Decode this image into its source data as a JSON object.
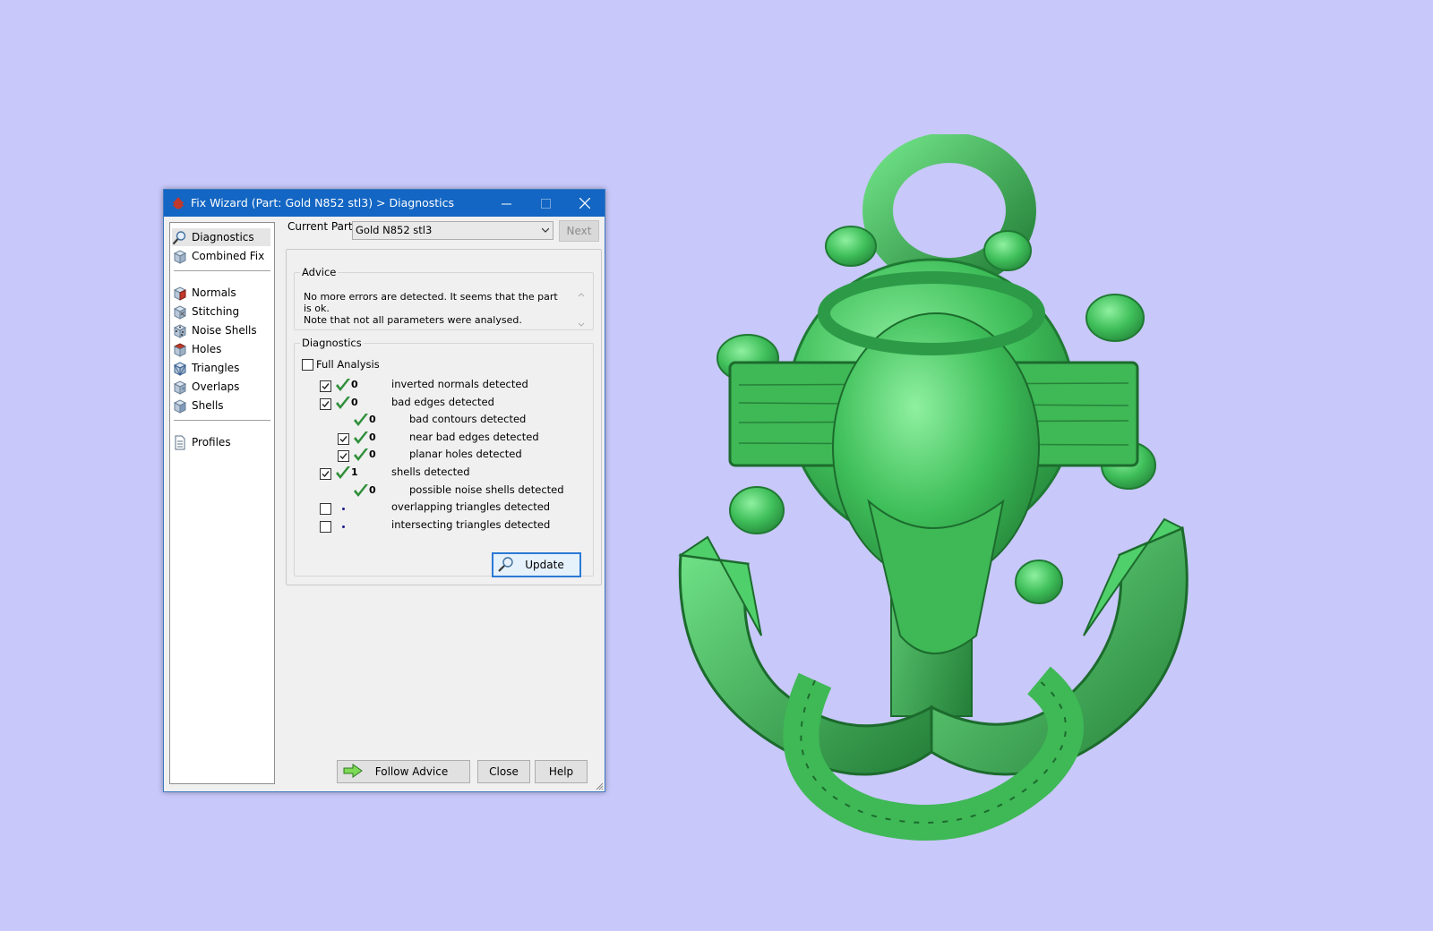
{
  "window": {
    "title": "Fix Wizard (Part: Gold N852 stl3) > Diagnostics"
  },
  "nav": {
    "items_top": [
      {
        "label": "Diagnostics",
        "icon": "magnifier-icon"
      },
      {
        "label": "Combined Fix",
        "icon": "cube-icon"
      }
    ],
    "items_mid": [
      {
        "label": "Normals",
        "icon": "normals-icon"
      },
      {
        "label": "Stitching",
        "icon": "stitching-icon"
      },
      {
        "label": "Noise Shells",
        "icon": "noise-shells-icon"
      },
      {
        "label": "Holes",
        "icon": "holes-icon"
      },
      {
        "label": "Triangles",
        "icon": "triangles-icon"
      },
      {
        "label": "Overlaps",
        "icon": "overlaps-icon"
      },
      {
        "label": "Shells",
        "icon": "shells-icon"
      }
    ],
    "items_bottom": [
      {
        "label": "Profiles",
        "icon": "document-icon"
      }
    ]
  },
  "current_part": {
    "label": "Current Part:",
    "value": "Gold N852 stl3",
    "next_label": "Next"
  },
  "advice": {
    "legend": "Advice",
    "text_line1": "No more errors are detected. It seems that the part is ok.",
    "text_line2": "Note that not all parameters were analysed."
  },
  "diagnostics": {
    "legend": "Diagnostics",
    "full_analysis_label": "Full Analysis",
    "rows": [
      {
        "count": "0",
        "text": "inverted normals detected",
        "checked": true
      },
      {
        "count": "0",
        "text": "bad edges detected",
        "checked": true
      },
      {
        "count": "0",
        "text": "bad contours detected"
      },
      {
        "count": "0",
        "text": "near bad edges detected",
        "checked": true
      },
      {
        "count": "0",
        "text": "planar holes detected",
        "checked": true
      },
      {
        "count": "1",
        "text": "shells detected",
        "checked": true
      },
      {
        "count": "0",
        "text": "possible noise shells detected"
      },
      {
        "count": "",
        "text": "overlapping triangles detected",
        "checked": false
      },
      {
        "count": "",
        "text": "intersecting triangles detected",
        "checked": false
      }
    ],
    "update_label": "Update"
  },
  "footer": {
    "follow_advice_label": "Follow Advice",
    "close_label": "Close",
    "help_label": "Help"
  },
  "colors": {
    "background": "#c8c8fa",
    "titlebar": "#1366c3",
    "check_green": "#2f8f3a",
    "model_green": "#3fbf5a"
  }
}
